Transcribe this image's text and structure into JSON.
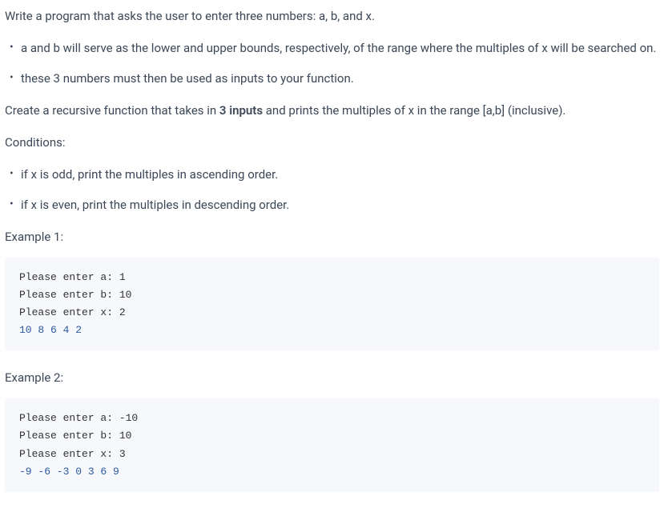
{
  "intro": "Write a program that asks the user to enter three numbers: a, b, and x.",
  "bullets1": [
    "a and b will serve as the lower and upper bounds, respectively, of the range where the multiples of x will be searched on.",
    "these 3 numbers must then be used as inputs to your function."
  ],
  "paragraph2_before": "Create a recursive function that takes in ",
  "paragraph2_bold": "3 inputs",
  "paragraph2_after": " and prints the multiples of x in the range [a,b] (inclusive).",
  "conditions_label": "Conditions:",
  "bullets2": [
    "if x is odd, print the multiples in ascending order.",
    "if x is even, print the multiples in descending order."
  ],
  "example1_label": "Example 1:",
  "example1_code": {
    "line1": "Please enter a: 1",
    "line2": "Please enter b: 10",
    "line3": "Please enter x: 2",
    "output": "10 8 6 4 2"
  },
  "example2_label": "Example 2:",
  "example2_code": {
    "line1": "Please enter a: -10",
    "line2": "Please enter b: 10",
    "line3": "Please enter x: 3",
    "output": "-9 -6 -3 0 3 6 9"
  }
}
